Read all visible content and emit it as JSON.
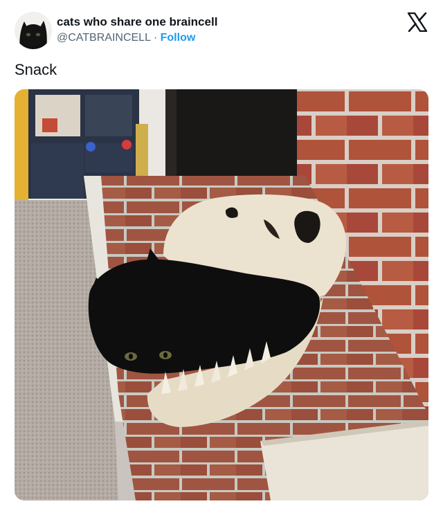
{
  "author": {
    "display_name": "cats who share one braincell",
    "handle": "@CATBRAINCELL",
    "separator": "·",
    "follow_label": "Follow"
  },
  "platform_icon": "x-logo-icon",
  "tweet": {
    "text": "Snack"
  },
  "colors": {
    "follow_link": "#1d9bf0",
    "name_text": "#0f1419",
    "meta_text": "#536471"
  }
}
